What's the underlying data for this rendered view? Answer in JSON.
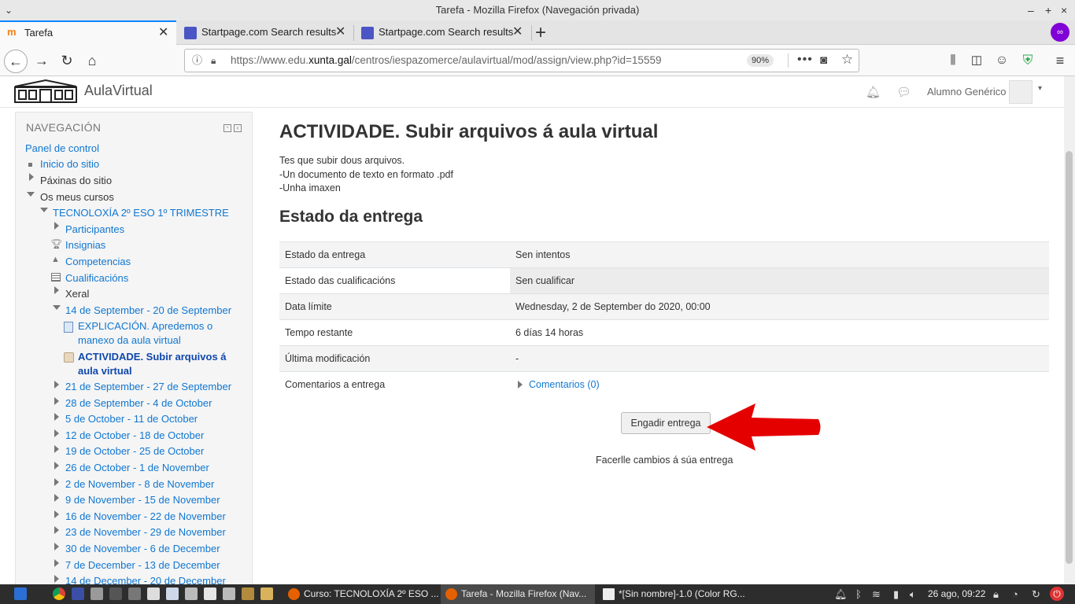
{
  "window": {
    "title": "Tarefa - Mozilla Firefox (Navegación privada)"
  },
  "tabs": [
    {
      "label": "Tarefa",
      "active": true
    },
    {
      "label": "Startpage.com Search results",
      "active": false
    },
    {
      "label": "Startpage.com Search results",
      "active": false
    }
  ],
  "urlbar": {
    "url_prefix": "https://www.edu.",
    "url_domain": "xunta.gal",
    "url_path": "/centros/iespazomerce/aulavirtual/mod/assign/view.php?id=15559",
    "zoom": "90%"
  },
  "site": {
    "brand": "AulaVirtual",
    "user": "Alumno Genérico"
  },
  "nav": {
    "title": "NAVEGACIÓN",
    "dashboard": "Panel de control",
    "home": "Inicio do sitio",
    "site_pages": "Páxinas do sitio",
    "my_courses": "Os meus cursos",
    "course": "TECNOLOXÍA 2º ESO 1º TRIMESTRE",
    "participants": "Participantes",
    "badges": "Insignias",
    "competencies": "Competencias",
    "grades": "Cualificacións",
    "general": "Xeral",
    "current_week": "14 de September - 20 de September",
    "activity1_line1": "EXPLICACIÓN. Apredemos o",
    "activity1_line2": "manexo da aula virtual",
    "activity2_line1": "ACTIVIDADE. Subir arquivos á",
    "activity2_line2": "aula virtual",
    "weeks": [
      "21 de September - 27 de September",
      "28 de September - 4 de October",
      "5 de October - 11 de October",
      "12 de October - 18 de October",
      "19 de October - 25 de October",
      "26 de October - 1 de November",
      "2 de November - 8 de November",
      "9 de November - 15 de November",
      "16 de November - 22 de November",
      "23 de November - 29 de November",
      "30 de November - 6 de December",
      "7 de December - 13 de December",
      "14 de December - 20 de December"
    ]
  },
  "main": {
    "title": "ACTIVIDADE. Subir arquivos á aula virtual",
    "intro": [
      "Tes que subir dous arquivos.",
      "-Un documento de texto en formato .pdf",
      "-Unha imaxen"
    ],
    "status_heading": "Estado da entrega",
    "rows": [
      {
        "label": "Estado da entrega",
        "value": "Sen intentos"
      },
      {
        "label": "Estado das cualificacións",
        "value": "Sen cualificar"
      },
      {
        "label": "Data límite",
        "value": "Wednesday, 2 de September do 2020, 00:00"
      },
      {
        "label": "Tempo restante",
        "value": "6 días 14 horas"
      },
      {
        "label": "Última modificación",
        "value": "-"
      },
      {
        "label": "Comentarios a entrega",
        "value": "Comentarios (0)"
      }
    ],
    "add_submission": "Engadir entrega",
    "hint": "Facerlle cambios á súa entrega",
    "arrow_color": "#e50000"
  },
  "taskbar": {
    "tasks": [
      {
        "label": "Curso: TECNOLOXÍA 2º ESO ...",
        "active": false
      },
      {
        "label": "Tarefa - Mozilla Firefox (Nav...",
        "active": true
      },
      {
        "label": "*[Sin nombre]-1.0 (Color RG...",
        "active": false
      }
    ],
    "clock": "26 ago, 09:22"
  }
}
